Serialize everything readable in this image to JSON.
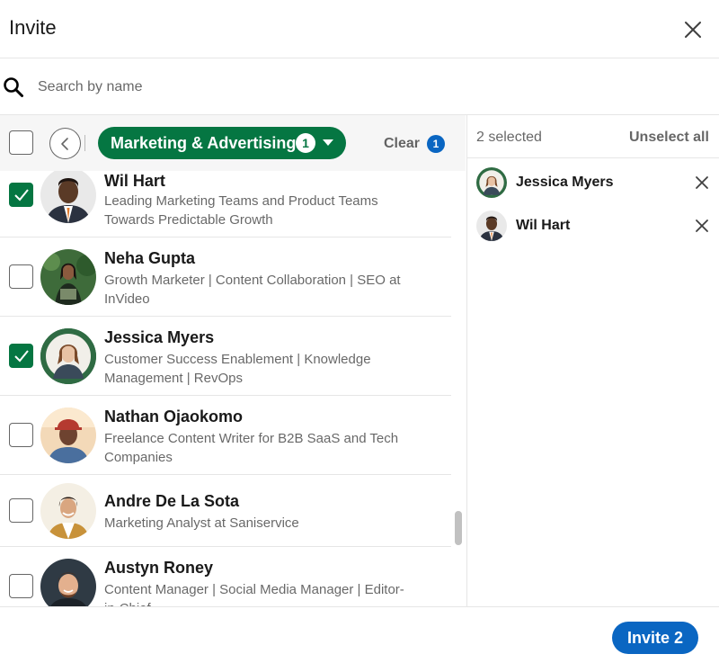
{
  "dialog": {
    "title": "Invite"
  },
  "search": {
    "placeholder": "Search by name",
    "value": ""
  },
  "filter": {
    "label": "Marketing & Advertising",
    "count": "1",
    "clear_label": "Clear",
    "clear_count": "1"
  },
  "people": [
    {
      "name": "Wil Hart",
      "headline": "Leading Marketing Teams and Product Teams Towards Predictable Growth",
      "checked": true
    },
    {
      "name": "Neha Gupta",
      "headline": "Growth Marketer | Content Collaboration | SEO at InVideo",
      "checked": false
    },
    {
      "name": "Jessica Myers",
      "headline": "Customer Success Enablement | Knowledge Management | RevOps",
      "checked": true
    },
    {
      "name": "Nathan Ojaokomo",
      "headline": "Freelance Content Writer for B2B SaaS and Tech Companies",
      "checked": false
    },
    {
      "name": "Andre De La Sota",
      "headline": "Marketing Analyst at Saniservice",
      "checked": false
    },
    {
      "name": "Austyn Roney",
      "headline": "Content Manager | Social Media Manager | Editor-in-Chief",
      "checked": false
    }
  ],
  "selected": {
    "count_label": "2 selected",
    "unselect_label": "Unselect all",
    "items": [
      {
        "name": "Jessica Myers"
      },
      {
        "name": "Wil Hart"
      }
    ]
  },
  "footer": {
    "invite_label": "Invite 2"
  },
  "colors": {
    "green": "#057642",
    "blue": "#0a66c2"
  }
}
